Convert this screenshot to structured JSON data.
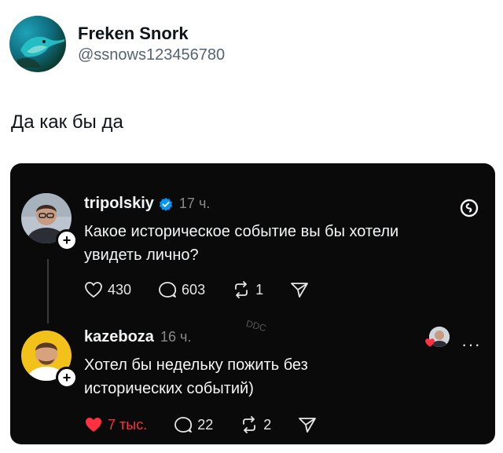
{
  "tweet": {
    "author_name": "Freken Snork",
    "author_handle": "@ssnows123456780",
    "text": "Да как бы да",
    "avatar_icon": "hummingbird-avatar"
  },
  "embed": {
    "platform_icon": "threads-logo-icon",
    "watermark": "DDC",
    "posts": [
      {
        "username": "tripolskiy",
        "verified": true,
        "time": "17 ч.",
        "text_line1": "Какое историческое событие вы бы хотели",
        "text_line2": "увидеть лично?",
        "likes": "430",
        "replies": "603",
        "reposts": "1"
      },
      {
        "username": "kazeboza",
        "verified": false,
        "time": "16 ч.",
        "text_line1": "Хотел бы недельку пожить без",
        "text_line2": "исторических событий)",
        "likes": "7 тыс.",
        "liked": true,
        "replies": "22",
        "reposts": "2"
      }
    ]
  },
  "colors": {
    "card_bg": "#0a0a0a",
    "verified_blue": "#0095f6",
    "like_red": "#ff3040",
    "muted": "#8a8a8a"
  }
}
